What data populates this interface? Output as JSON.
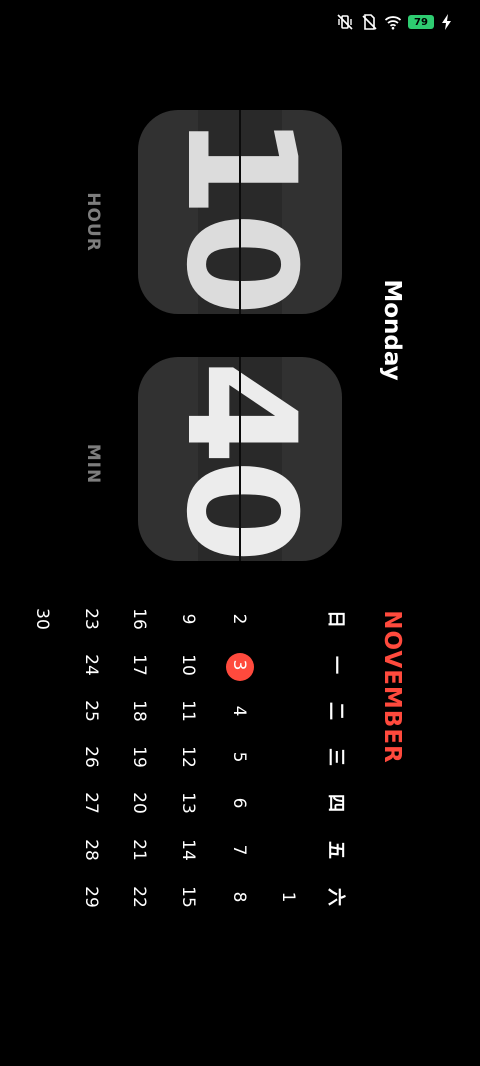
{
  "status_bar": {
    "icons": [
      "vibrate-icon",
      "no-sim-icon",
      "wifi-icon",
      "battery-icon",
      "charging-icon"
    ],
    "battery_level": "79",
    "battery_color": "#2ecc71"
  },
  "clock": {
    "hour": "10",
    "minute": "40",
    "hour_label": "HOUR",
    "minute_label": "MIN",
    "weekday": "Monday"
  },
  "calendar": {
    "month": "NOVEMBER",
    "accent_color": "#ff4a3d",
    "weekday_headers": [
      "日",
      "一",
      "二",
      "三",
      "四",
      "五",
      "六"
    ],
    "today": "3",
    "weeks": [
      [
        "",
        "",
        "",
        "",
        "",
        "",
        "1"
      ],
      [
        "2",
        "3",
        "4",
        "5",
        "6",
        "7",
        "8"
      ],
      [
        "9",
        "10",
        "11",
        "12",
        "13",
        "14",
        "15"
      ],
      [
        "16",
        "17",
        "18",
        "19",
        "20",
        "21",
        "22"
      ],
      [
        "23",
        "24",
        "25",
        "26",
        "27",
        "28",
        "29"
      ],
      [
        "30",
        "",
        "",
        "",
        "",
        "",
        ""
      ]
    ]
  }
}
